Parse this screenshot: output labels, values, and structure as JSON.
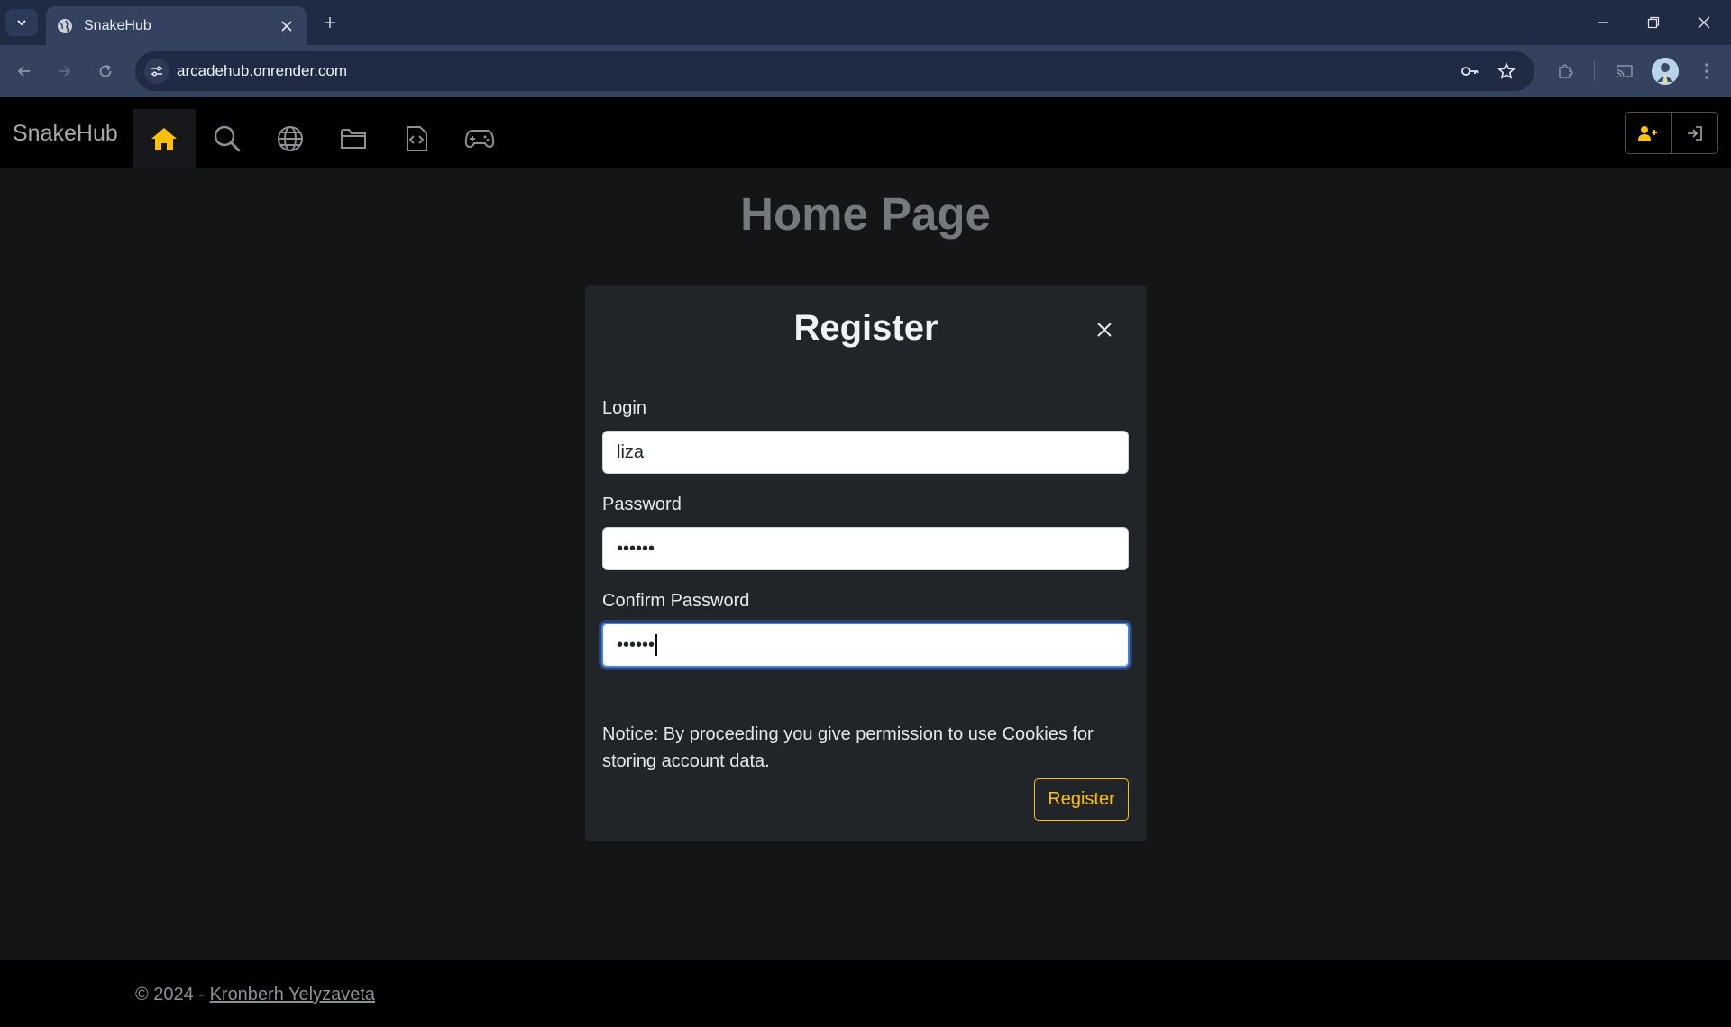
{
  "browser": {
    "tab_title": "SnakeHub",
    "url": "arcadehub.onrender.com"
  },
  "site": {
    "brand": "SnakeHub",
    "nav_items": [
      "home-icon",
      "search-icon",
      "globe-icon",
      "folder-icon",
      "code-file-icon",
      "gamepad-icon"
    ],
    "active_nav": "home-icon",
    "accent": "#ffc107"
  },
  "page": {
    "title": "Home Page"
  },
  "modal": {
    "title": "Register",
    "login_label": "Login",
    "login_value": "liza",
    "password_label": "Password",
    "password_value": "••••••",
    "confirm_label": "Confirm Password",
    "confirm_value": "••••••",
    "notice": "Notice: By proceeding you give permission to use Cookies for storing account data.",
    "submit_label": "Register"
  },
  "footer": {
    "prefix": "© 2024 - ",
    "author": "Kronberh Yelyzaveta"
  }
}
